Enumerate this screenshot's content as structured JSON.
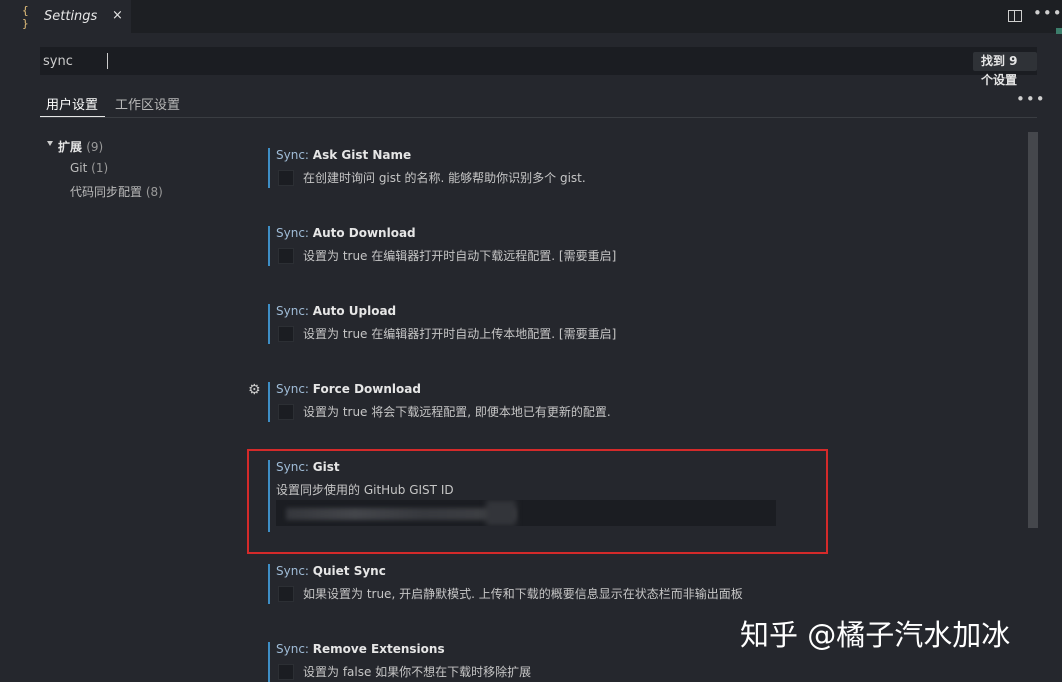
{
  "tab": {
    "icon": "json-braces-icon",
    "title": "Settings",
    "close": "×"
  },
  "toolbar": {
    "split_icon": "split-editor-icon",
    "more": "•••"
  },
  "search": {
    "value": "sync",
    "result_count": "找到 9 个设置"
  },
  "scope_tabs": {
    "user": "用户设置",
    "workspace": "工作区设置",
    "more": "•••"
  },
  "toc": {
    "extensions": {
      "label": "扩展",
      "count": "(9)"
    },
    "git": {
      "label": "Git",
      "count": "(1)"
    },
    "sync_config": {
      "label": "代码同步配置",
      "count": "(8)"
    }
  },
  "settings": [
    {
      "category": "Sync: ",
      "name": "Ask Gist Name",
      "description": "在创建时询问 gist 的名称. 能够帮助你识别多个 gist."
    },
    {
      "category": "Sync: ",
      "name": "Auto Download",
      "description": "设置为 true 在编辑器打开时自动下载远程配置. [需要重启]"
    },
    {
      "category": "Sync: ",
      "name": "Auto Upload",
      "description": "设置为 true 在编辑器打开时自动上传本地配置. [需要重启]"
    },
    {
      "category": "Sync: ",
      "name": "Force Download",
      "description": "设置为 true 将会下载远程配置, 即便本地已有更新的配置."
    },
    {
      "category": "Sync: ",
      "name": "Gist",
      "description": "设置同步使用的 GitHub GIST ID"
    },
    {
      "category": "Sync: ",
      "name": "Quiet Sync",
      "description": "如果设置为 true, 开启静默模式. 上传和下载的概要信息显示在状态栏而非输出面板"
    },
    {
      "category": "Sync: ",
      "name": "Remove Extensions",
      "description": "设置为 false 如果你不想在下载时移除扩展"
    }
  ],
  "watermark": "知乎 @橘子汽水加冰",
  "colors": {
    "accent_bar": "#3e8ec5",
    "highlight_box": "#d42a2a",
    "background": "#25272d"
  }
}
